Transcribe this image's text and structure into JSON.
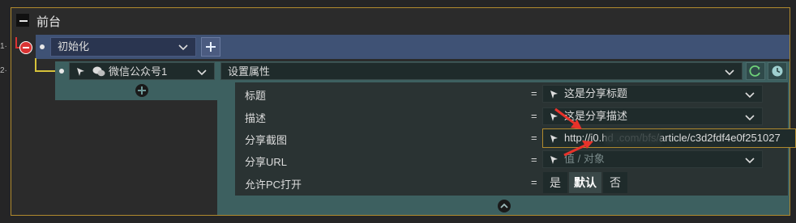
{
  "section": {
    "title": "前台"
  },
  "gutter": {
    "line1": "1·",
    "line2": "2·"
  },
  "init": {
    "label": "初始化"
  },
  "wechat": {
    "label": "微信公众号1"
  },
  "setprop": {
    "label": "设置属性"
  },
  "properties": [
    {
      "label": "标题",
      "eq": "=",
      "value": "这是分享标题"
    },
    {
      "label": "描述",
      "eq": "=",
      "value": "这是分享描述"
    },
    {
      "label": "分享截图",
      "eq": "=",
      "value": "http://i0.hd     .com/bfs/article/c3d2fdf4e0f251027"
    },
    {
      "label": "分享URL",
      "eq": "=",
      "value": "值 / 对象"
    },
    {
      "label": "允许PC打开",
      "eq": "="
    }
  ],
  "pc_options": {
    "yes": "是",
    "default": "默认",
    "no": "否",
    "selected": "default"
  },
  "colors": {
    "frame": "#b08a2e",
    "header_blue": "#3f5275",
    "teal_panel": "#3d6060",
    "stop_red": "#d93333",
    "link_yellow": "#d6c23a",
    "annotation_red": "#e8322a"
  },
  "icons": [
    "minus-icon",
    "stop-icon",
    "plus-icon",
    "dot-icon",
    "cursor-arrow-icon",
    "wechat-icon",
    "chevron-down-icon",
    "refresh-icon",
    "clock-icon",
    "add-circle-icon",
    "chevron-up-icon"
  ]
}
